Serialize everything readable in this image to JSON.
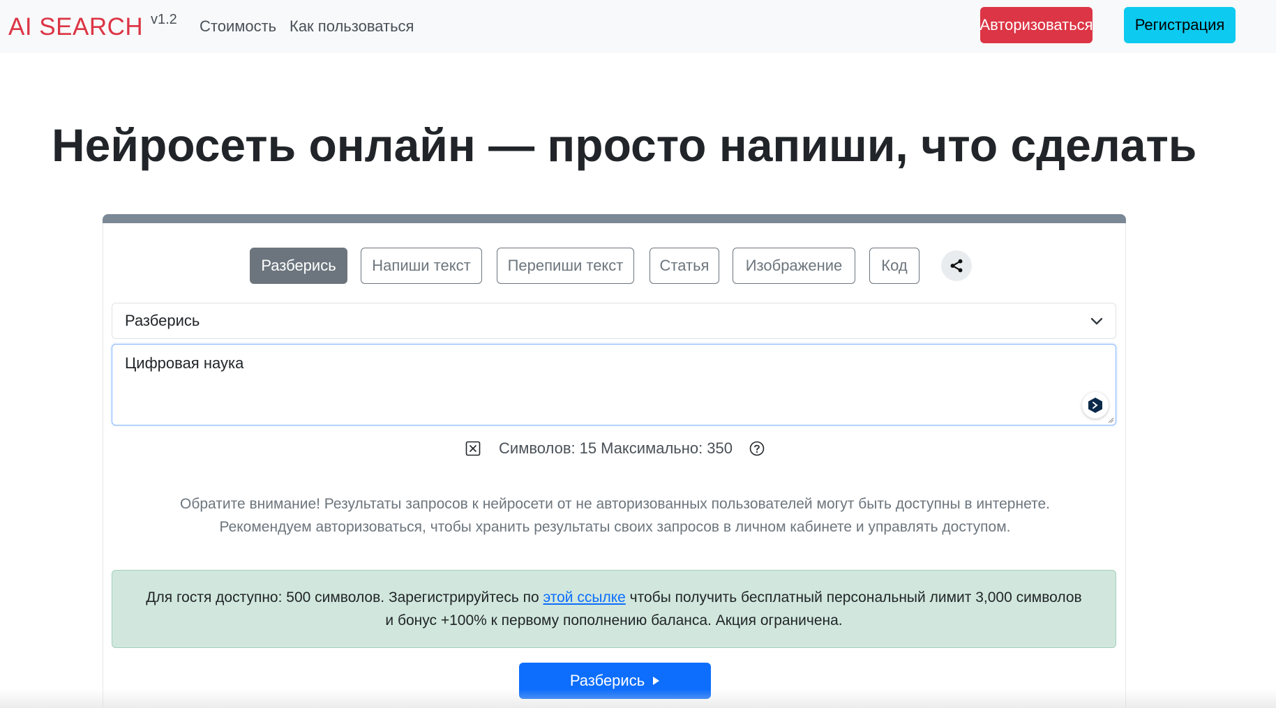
{
  "navbar": {
    "brand": "AI SEARCH",
    "version": "v1.2",
    "links": [
      "Стоимость",
      "Как пользоваться"
    ],
    "login_label": "Авторизоваться",
    "register_label": "Регистрация"
  },
  "headline": "Нейросеть онлайн — просто напиши, что сделать",
  "tabs": [
    {
      "label": "Разберись",
      "active": true
    },
    {
      "label": "Напиши текст",
      "active": false
    },
    {
      "label": "Перепиши текст",
      "active": false
    },
    {
      "label": "Статья",
      "active": false
    },
    {
      "label": "Изображение",
      "active": false
    },
    {
      "label": "Код",
      "active": false
    }
  ],
  "mode_select": {
    "selected": "Разберись"
  },
  "prompt": {
    "value": "Цифровая наука"
  },
  "counter": {
    "symbols_label": "Символов:",
    "symbols": "15",
    "max_label": "Максимально:",
    "max": "350"
  },
  "notice": {
    "line1": "Обратите внимание! Результаты запросов к нейросети от не авторизованных пользователей могут быть доступны в интернете.",
    "line2": "Рекомендуем авторизоваться, чтобы хранить результаты своих запросов в личном кабинете и управлять доступом."
  },
  "alert": {
    "before_link": "Для гостя доступно: 500 символов. Зарегистрируйтесь по ",
    "link_text": "этой ссылке",
    "after_link": " чтобы получить бесплатный персональный лимит 3,000 символов",
    "line2": "и бонус +100% к первому пополнению баланса. Акция ограничена."
  },
  "submit_label": "Разберись",
  "colors": {
    "brand": "#dc3545",
    "primary": "#0d6efd",
    "info": "#0dcaf0",
    "secondary": "#6c757d",
    "success_bg": "#d1e7dd"
  },
  "icons": [
    "share-icon",
    "chevron-down-icon",
    "assistant-widget-icon",
    "clear-icon",
    "help-icon",
    "caret-right-icon"
  ]
}
